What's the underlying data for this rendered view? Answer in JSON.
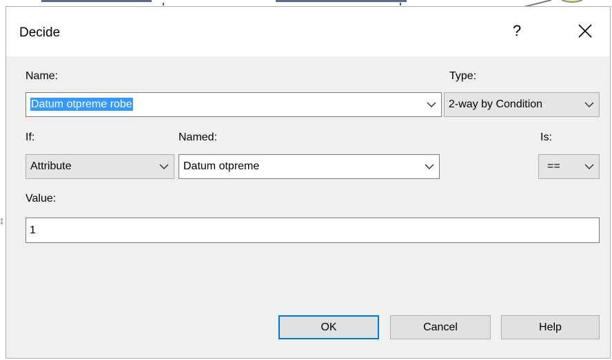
{
  "window": {
    "title": "Decide",
    "help_glyph": "?",
    "close_icon": "close-icon"
  },
  "name": {
    "label": "Name:",
    "value": "Datum otpreme robe"
  },
  "type": {
    "label": "Type:",
    "value": "2-way by Condition"
  },
  "if": {
    "label": "If:",
    "value": "Attribute"
  },
  "named": {
    "label": "Named:",
    "value": "Datum otpreme"
  },
  "is": {
    "label": "Is:",
    "value": "=="
  },
  "value": {
    "label": "Value:",
    "value": "1"
  },
  "buttons": {
    "ok": "OK",
    "cancel": "Cancel",
    "help": "Help"
  },
  "colors": {
    "accent": "#0078d7",
    "selection": "#3399ff",
    "dialog_bg": "#f0f0f0"
  }
}
